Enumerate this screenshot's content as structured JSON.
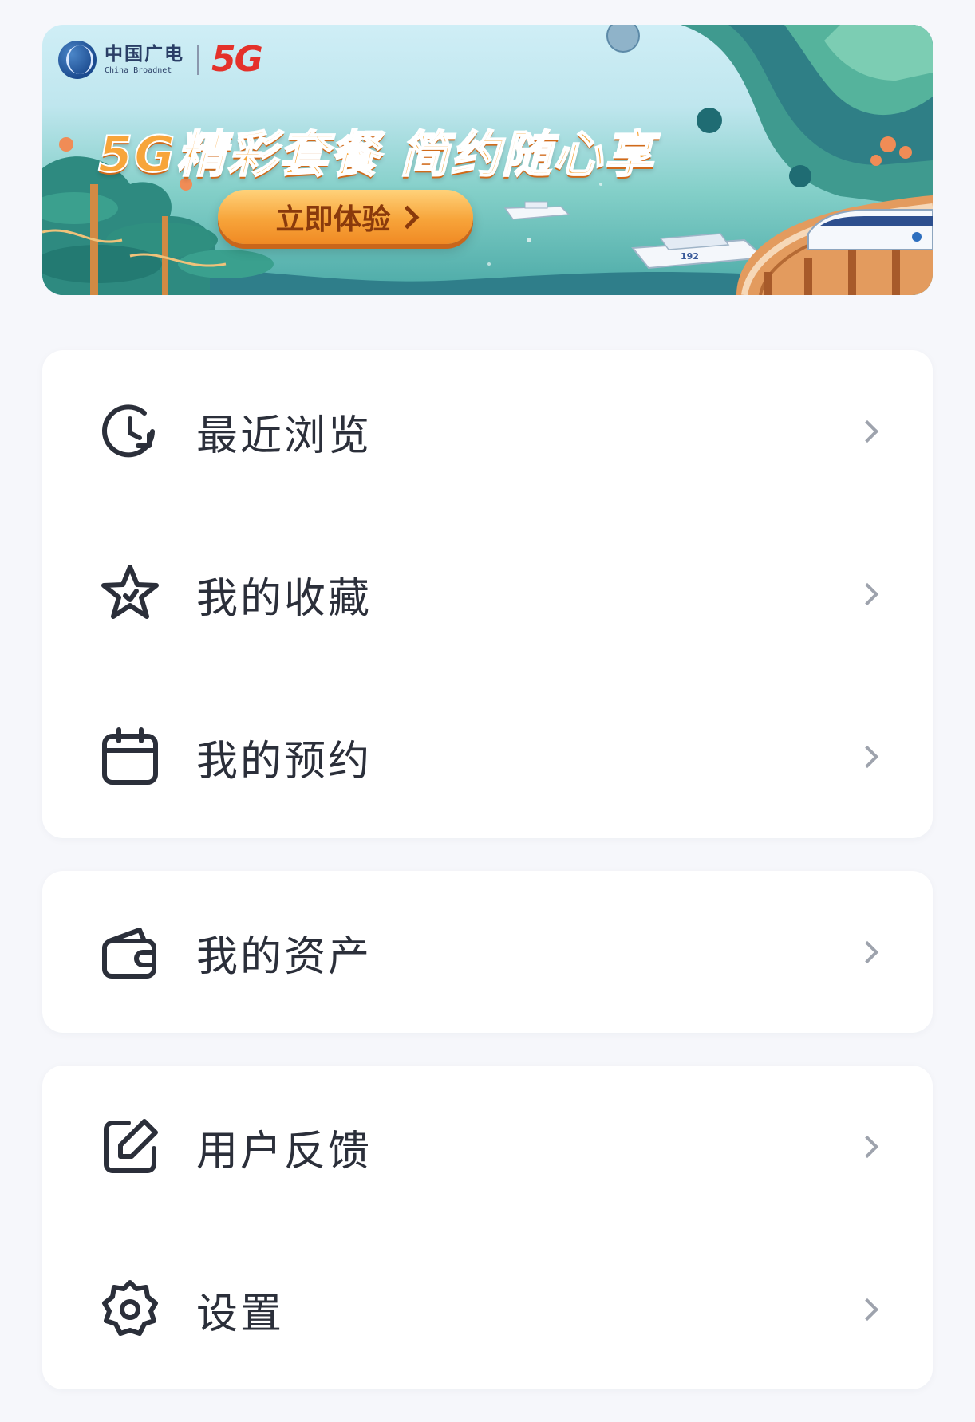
{
  "banner": {
    "brand_cn": "中国广电",
    "brand_en": "China Broadnet",
    "brand_5g": "5G",
    "slogan": "5G精彩套餐 简约随心享",
    "cta_label": "立即体验",
    "boat_number": "192"
  },
  "menu_groups": [
    {
      "items": [
        {
          "label": "最近浏览",
          "icon": "history-clock-icon"
        },
        {
          "label": "我的收藏",
          "icon": "star-icon"
        },
        {
          "label": "我的预约",
          "icon": "calendar-icon"
        }
      ]
    },
    {
      "items": [
        {
          "label": "我的资产",
          "icon": "wallet-icon"
        }
      ]
    },
    {
      "items": [
        {
          "label": "用户反馈",
          "icon": "edit-icon"
        },
        {
          "label": "设置",
          "icon": "gear-icon"
        }
      ]
    }
  ],
  "colors": {
    "background": "#f6f7fb",
    "card": "#ffffff",
    "text": "#2b2f3a",
    "arrow": "#9ea3ad",
    "icon_stroke": "#2b2f3a",
    "cta_orange": "#f7a43a",
    "brand_red": "#e4312a"
  }
}
